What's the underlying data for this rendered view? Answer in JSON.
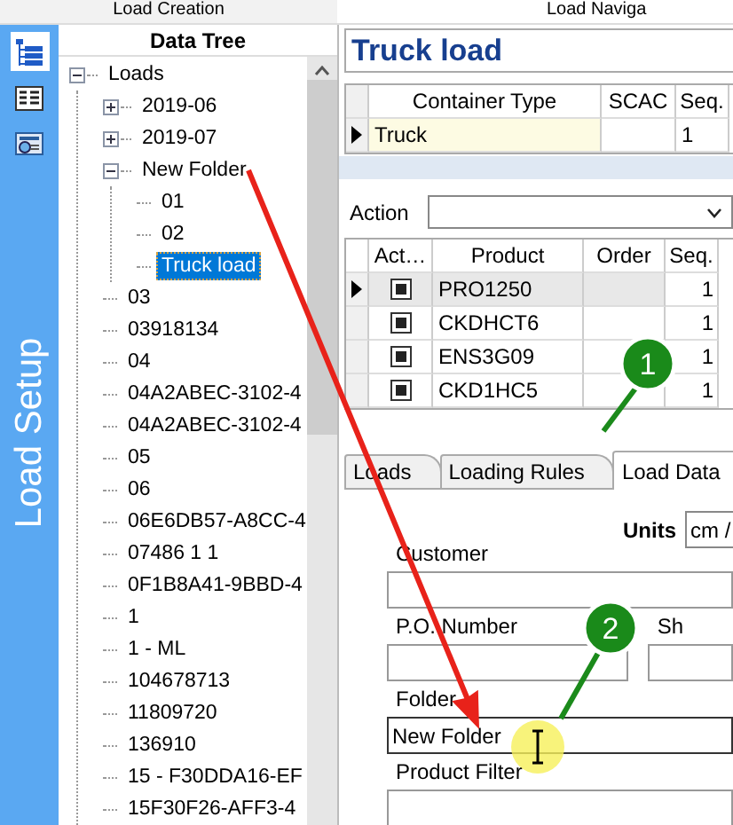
{
  "top_tabs": [
    {
      "label": "Load Creation"
    },
    {
      "label": "Load Naviga"
    }
  ],
  "sidebar": {
    "title": "Load Setup",
    "items": [
      {
        "kind": "tree",
        "selected": true
      },
      {
        "kind": "list",
        "selected": false
      },
      {
        "kind": "report",
        "selected": false
      }
    ]
  },
  "data_tree": {
    "title": "Data Tree",
    "nodes": [
      {
        "label": "Loads",
        "expanded": true,
        "selected": false,
        "children": [
          {
            "label": "2019-06",
            "expanded": false,
            "selected": false
          },
          {
            "label": "2019-07",
            "expanded": false,
            "selected": false
          },
          {
            "label": "New Folder",
            "expanded": true,
            "selected": false,
            "children": [
              {
                "label": "01",
                "selected": false
              },
              {
                "label": "02",
                "selected": false
              },
              {
                "label": "Truck load",
                "selected": true
              }
            ]
          },
          {
            "label": "03",
            "selected": false
          },
          {
            "label": "03918134",
            "selected": false
          },
          {
            "label": "04",
            "selected": false
          },
          {
            "label": "04A2ABEC-3102-4",
            "selected": false
          },
          {
            "label": "04A2ABEC-3102-4",
            "selected": false
          },
          {
            "label": "05",
            "selected": false
          },
          {
            "label": "06",
            "selected": false
          },
          {
            "label": "06E6DB57-A8CC-4",
            "selected": false
          },
          {
            "label": "07486  1 1",
            "selected": false
          },
          {
            "label": "0F1B8A41-9BBD-4",
            "selected": false
          },
          {
            "label": "1",
            "selected": false
          },
          {
            "label": "1 - ML",
            "selected": false
          },
          {
            "label": "104678713",
            "selected": false
          },
          {
            "label": "11809720",
            "selected": false
          },
          {
            "label": "136910",
            "selected": false
          },
          {
            "label": "15 - F30DDA16-EF",
            "selected": false
          },
          {
            "label": "15F30F26-AFF3-4",
            "selected": false
          }
        ]
      }
    ]
  },
  "detail": {
    "title": "Truck load",
    "container_grid": {
      "columns": [
        "Container Type",
        "SCAC",
        "Seq."
      ],
      "rows": [
        {
          "current": true,
          "container_type": "Truck",
          "seq": "1"
        }
      ]
    },
    "action": {
      "label": "Action"
    },
    "product_grid": {
      "columns": [
        "Act…",
        "Product",
        "Order",
        "Seq."
      ],
      "rows": [
        {
          "current": true,
          "checked": true,
          "product": "PRO1250",
          "seq": "1"
        },
        {
          "current": false,
          "checked": true,
          "product": "CKDHCT6",
          "seq": "1"
        },
        {
          "current": false,
          "checked": true,
          "product": "ENS3G09",
          "seq": "1"
        },
        {
          "current": false,
          "checked": true,
          "product": "CKD1HC5",
          "seq": "1"
        }
      ]
    },
    "tabs": [
      {
        "label": "Loads",
        "selected": false
      },
      {
        "label": "Loading Rules",
        "selected": false
      },
      {
        "label": "Load Data",
        "selected": true
      }
    ],
    "form": {
      "units": {
        "label": "Units",
        "value": "cm /"
      },
      "rows": [
        [
          {
            "label": "Customer",
            "focused": false
          }
        ],
        [
          {
            "label": "P.O. Number",
            "focused": false
          },
          {
            "label": "Sh",
            "focused": false
          }
        ],
        [
          {
            "label": "Folder",
            "value": "New Folder",
            "focused": true
          }
        ],
        [
          {
            "label": "Product Filter",
            "focused": false
          }
        ]
      ]
    }
  },
  "callouts": [
    {
      "number": "1"
    },
    {
      "number": "2"
    }
  ]
}
